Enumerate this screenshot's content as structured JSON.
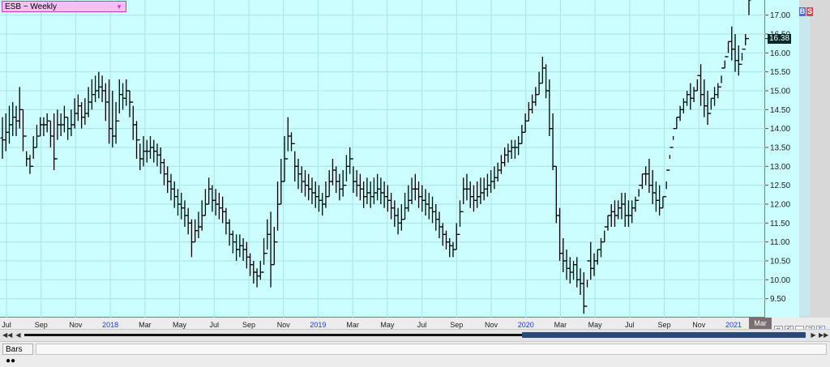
{
  "symbol_selector": {
    "text": "ESB ~ Weekly",
    "icon": "chevron-down-icon"
  },
  "buttons": {
    "buy": "B",
    "sell": "S"
  },
  "last_price": "16.38",
  "x_labels": [
    {
      "label": "Jul",
      "year": false
    },
    {
      "label": "Sep",
      "year": false
    },
    {
      "label": "Nov",
      "year": false
    },
    {
      "label": "2018",
      "year": true
    },
    {
      "label": "Mar",
      "year": false
    },
    {
      "label": "May",
      "year": false
    },
    {
      "label": "Jul",
      "year": false
    },
    {
      "label": "Sep",
      "year": false
    },
    {
      "label": "Nov",
      "year": false
    },
    {
      "label": "2019",
      "year": true
    },
    {
      "label": "Mar",
      "year": false
    },
    {
      "label": "May",
      "year": false
    },
    {
      "label": "Jul",
      "year": false
    },
    {
      "label": "Sep",
      "year": false
    },
    {
      "label": "Nov",
      "year": false
    },
    {
      "label": "2020",
      "year": true
    },
    {
      "label": "Mar",
      "year": false
    },
    {
      "label": "May",
      "year": false
    },
    {
      "label": "Jul",
      "year": false
    },
    {
      "label": "Sep",
      "year": false
    },
    {
      "label": "Nov",
      "year": false
    },
    {
      "label": "2021",
      "year": true
    }
  ],
  "current_month_marker": "Mar",
  "status_bar": {
    "tab_label": "Bars"
  },
  "colors": {
    "background": "#ccfeff",
    "bars": "#000000",
    "axis_line": "#e05050",
    "year_label": "#1a3fd8"
  },
  "chart_data": {
    "type": "bar",
    "style": "ohlc",
    "title": "ESB ~ Weekly",
    "timeframe": "Weekly",
    "ylim": [
      9.0,
      17.4
    ],
    "y_ticks": [
      9.5,
      10.0,
      10.5,
      11.0,
      11.5,
      12.0,
      12.5,
      13.0,
      13.5,
      14.0,
      14.5,
      15.0,
      15.5,
      16.0,
      16.5,
      17.0
    ],
    "grid": true,
    "last_value": 16.38,
    "x_start": "2017-07-03",
    "interval_days": 7,
    "highs": [
      14.3,
      14.4,
      14.6,
      14.7,
      14.6,
      15.1,
      14.5,
      13.4,
      13.3,
      13.8,
      14.1,
      14.3,
      14.3,
      14.4,
      14.2,
      14.4,
      14.5,
      14.4,
      14.6,
      14.3,
      14.5,
      14.8,
      14.9,
      14.7,
      14.8,
      15.1,
      15.3,
      15.4,
      15.5,
      15.4,
      15.2,
      15.3,
      15.0,
      14.7,
      15.3,
      15.2,
      15.3,
      15.0,
      14.6,
      14.2,
      13.6,
      13.8,
      13.7,
      13.8,
      13.7,
      13.6,
      13.5,
      13.2,
      13.0,
      12.8,
      12.6,
      12.4,
      12.3,
      12.1,
      11.9,
      11.6,
      11.6,
      11.8,
      12.1,
      12.4,
      12.7,
      12.5,
      12.4,
      12.3,
      12.2,
      11.9,
      11.6,
      11.3,
      11.2,
      11.2,
      11.1,
      11.0,
      10.7,
      10.5,
      10.3,
      10.5,
      11.1,
      11.6,
      11.8,
      11.4,
      12.6,
      13.2,
      13.8,
      14.3,
      13.9,
      13.4,
      13.2,
      13.0,
      12.9,
      12.8,
      12.7,
      12.6,
      12.5,
      12.3,
      12.6,
      12.9,
      13.2,
      13.0,
      12.8,
      12.9,
      13.3,
      13.5,
      13.0,
      12.9,
      12.8,
      12.6,
      12.7,
      12.6,
      12.7,
      12.8,
      12.7,
      12.6,
      12.5,
      12.3,
      12.1,
      11.9,
      12.0,
      12.3,
      12.5,
      12.7,
      12.8,
      12.6,
      12.5,
      12.4,
      12.3,
      12.2,
      12.0,
      11.8,
      11.5,
      11.3,
      11.1,
      11.0,
      11.5,
      12.1,
      12.7,
      12.8,
      12.6,
      12.5,
      12.6,
      12.7,
      12.7,
      12.8,
      12.9,
      13.0,
      13.1,
      13.3,
      13.5,
      13.6,
      13.7,
      13.7,
      13.8,
      14.1,
      14.4,
      14.7,
      14.9,
      15.1,
      15.5,
      15.9,
      15.7,
      15.3,
      14.4,
      13.0,
      11.9,
      11.1,
      10.8,
      10.6,
      10.5,
      10.6,
      10.3,
      10.2,
      10.0,
      11.0,
      10.7,
      10.8,
      11.1,
      11.3,
      11.7,
      12.0,
      12.1,
      12.1,
      12.3,
      12.3,
      12.1,
      12.1,
      12.2,
      12.4,
      12.8,
      13.0,
      13.2,
      12.9,
      12.6,
      12.5,
      12.2,
      12.4,
      13.3,
      13.8,
      14.3,
      14.6,
      14.8,
      15.0,
      15.2,
      15.1,
      15.3,
      15.7,
      15.3,
      15.0,
      14.8,
      15.1,
      15.2,
      15.4,
      15.8,
      16.3,
      16.7,
      16.5,
      16.2,
      16.0,
      16.5,
      17.0
    ],
    "lows": [
      13.2,
      13.4,
      13.6,
      13.8,
      13.8,
      14.0,
      13.4,
      13.0,
      12.8,
      13.2,
      13.5,
      13.8,
      13.8,
      13.9,
      13.5,
      12.9,
      13.7,
      13.8,
      13.9,
      13.7,
      13.8,
      14.0,
      14.2,
      14.0,
      14.1,
      14.3,
      14.5,
      14.7,
      14.8,
      14.7,
      14.2,
      13.6,
      13.5,
      13.6,
      14.4,
      14.5,
      14.6,
      14.3,
      13.7,
      13.2,
      12.9,
      13.0,
      13.1,
      13.2,
      13.1,
      13.0,
      12.8,
      12.5,
      12.3,
      12.1,
      11.9,
      11.7,
      11.6,
      11.4,
      11.2,
      10.6,
      11.0,
      11.1,
      11.3,
      11.7,
      12.0,
      11.8,
      11.7,
      11.6,
      11.5,
      11.2,
      10.9,
      10.7,
      10.5,
      10.6,
      10.5,
      10.3,
      10.1,
      9.9,
      9.8,
      10.0,
      10.4,
      10.8,
      9.8,
      10.4,
      11.3,
      12.0,
      12.6,
      13.4,
      13.4,
      12.6,
      12.4,
      12.3,
      12.2,
      12.1,
      12.0,
      11.9,
      11.8,
      11.7,
      11.9,
      12.2,
      12.5,
      12.3,
      12.1,
      12.2,
      12.6,
      12.8,
      12.3,
      12.2,
      12.1,
      11.9,
      12.0,
      11.9,
      12.0,
      12.1,
      12.0,
      11.9,
      11.8,
      11.6,
      11.4,
      11.2,
      11.3,
      11.6,
      11.8,
      12.0,
      12.1,
      11.9,
      11.8,
      11.7,
      11.6,
      11.5,
      11.3,
      11.1,
      10.9,
      10.8,
      10.6,
      10.6,
      10.8,
      11.4,
      12.0,
      12.1,
      11.9,
      11.8,
      11.9,
      12.0,
      12.1,
      12.2,
      12.3,
      12.4,
      12.6,
      12.8,
      13.0,
      13.1,
      13.2,
      13.2,
      13.3,
      13.6,
      13.9,
      14.2,
      14.4,
      14.6,
      14.9,
      15.2,
      14.8,
      13.8,
      12.9,
      11.5,
      10.5,
      10.2,
      10.0,
      9.9,
      10.0,
      9.8,
      9.6,
      9.1,
      9.8,
      10.0,
      10.1,
      10.4,
      10.6,
      11.0,
      11.3,
      11.4,
      11.4,
      11.6,
      11.6,
      11.4,
      11.4,
      11.5,
      11.8,
      12.2,
      12.4,
      12.5,
      12.3,
      12.0,
      11.8,
      11.7,
      11.9,
      12.6,
      13.2,
      13.7,
      14.0,
      14.2,
      14.4,
      14.6,
      14.5,
      14.7,
      15.0,
      14.6,
      14.3,
      14.1,
      14.5,
      14.6,
      14.8,
      15.2,
      15.6,
      16.0,
      15.8,
      15.5,
      15.4,
      15.8,
      16.2
    ],
    "closes": [
      13.7,
      13.9,
      14.1,
      14.3,
      14.2,
      14.5,
      13.8,
      13.2,
      13.0,
      13.5,
      13.8,
      14.1,
      14.1,
      14.2,
      13.8,
      13.2,
      14.1,
      14.1,
      14.3,
      14.0,
      14.1,
      14.4,
      14.6,
      14.3,
      14.4,
      14.7,
      14.9,
      15.0,
      15.1,
      15.0,
      14.7,
      14.0,
      13.8,
      14.2,
      14.9,
      14.8,
      15.0,
      14.7,
      14.1,
      13.7,
      13.2,
      13.4,
      13.4,
      13.5,
      13.4,
      13.3,
      13.1,
      12.8,
      12.6,
      12.4,
      12.2,
      12.0,
      11.9,
      11.7,
      11.5,
      11.0,
      11.3,
      11.4,
      11.7,
      12.0,
      12.4,
      12.1,
      12.0,
      11.9,
      11.8,
      11.5,
      11.2,
      11.0,
      10.8,
      10.9,
      10.8,
      10.6,
      10.4,
      10.2,
      10.1,
      10.2,
      10.7,
      11.2,
      10.4,
      11.0,
      12.0,
      12.6,
      13.2,
      13.8,
      13.6,
      13.0,
      12.8,
      12.6,
      12.5,
      12.4,
      12.3,
      12.2,
      12.1,
      12.0,
      12.2,
      12.6,
      12.9,
      12.6,
      12.4,
      12.5,
      13.0,
      13.2,
      12.6,
      12.5,
      12.4,
      12.2,
      12.3,
      12.2,
      12.3,
      12.4,
      12.3,
      12.2,
      12.1,
      11.9,
      11.7,
      11.5,
      11.6,
      11.9,
      12.1,
      12.4,
      12.4,
      12.2,
      12.1,
      12.0,
      11.9,
      11.8,
      11.6,
      11.4,
      11.2,
      11.0,
      10.9,
      10.8,
      11.2,
      11.8,
      12.4,
      12.4,
      12.2,
      12.1,
      12.2,
      12.3,
      12.4,
      12.5,
      12.6,
      12.7,
      12.9,
      13.1,
      13.3,
      13.4,
      13.5,
      13.5,
      13.6,
      13.9,
      14.2,
      14.5,
      14.7,
      14.9,
      15.2,
      15.6,
      15.0,
      14.0,
      13.0,
      11.7,
      10.7,
      10.5,
      10.3,
      10.2,
      10.4,
      10.0,
      9.9,
      9.3,
      10.5,
      10.3,
      10.5,
      10.8,
      11.0,
      11.4,
      11.7,
      11.8,
      11.7,
      11.9,
      12.0,
      11.7,
      11.7,
      11.9,
      12.1,
      12.5,
      12.8,
      12.8,
      12.5,
      12.3,
      12.1,
      11.9,
      12.2,
      12.9,
      13.5,
      14.0,
      14.3,
      14.5,
      14.7,
      14.9,
      14.8,
      15.0,
      15.4,
      14.9,
      14.6,
      14.4,
      14.8,
      14.9,
      15.1,
      15.6,
      15.9,
      16.3,
      16.1,
      15.8,
      15.7,
      16.1,
      16.38
    ]
  }
}
